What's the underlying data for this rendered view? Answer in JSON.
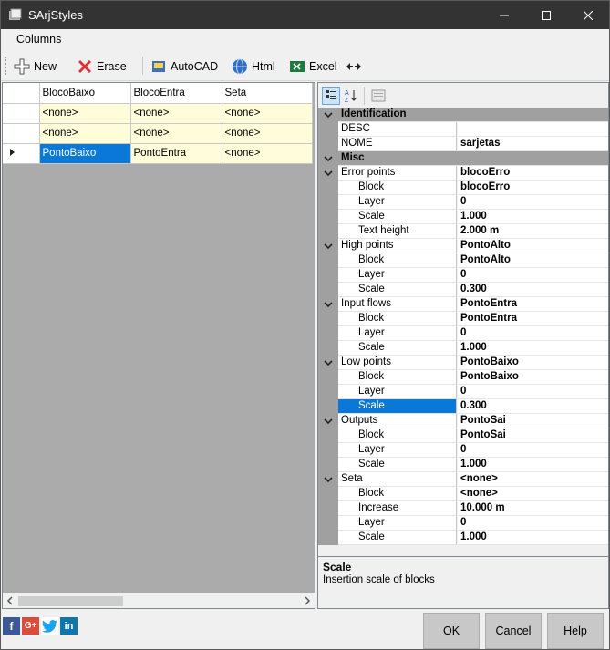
{
  "window": {
    "title": "SArjStyles"
  },
  "menu": {
    "columns": "Columns"
  },
  "toolbar": {
    "new": "New",
    "erase": "Erase",
    "autocad": "AutoCAD",
    "html": "Html",
    "excel": "Excel"
  },
  "grid": {
    "columns": [
      "BlocoBaixo",
      "BlocoEntra",
      "Seta"
    ],
    "rows": [
      [
        "<none>",
        "<none>",
        "<none>"
      ],
      [
        "<none>",
        "<none>",
        "<none>"
      ],
      [
        "PontoBaixo",
        "PontoEntra",
        "<none>"
      ]
    ]
  },
  "props": {
    "identification": {
      "label": "Identification",
      "desc": "DESC",
      "desc_value": "",
      "nome": "NOME",
      "nome_value": "sarjetas"
    },
    "misc": {
      "label": "Misc"
    },
    "error": {
      "label": "Error points",
      "value": "blocoErro",
      "block": "Block",
      "block_value": "blocoErro",
      "layer": "Layer",
      "layer_value": "0",
      "scale": "Scale",
      "scale_value": "1.000",
      "text_height": "Text height",
      "text_height_value": "2.000 m"
    },
    "high": {
      "label": "High points",
      "value": "PontoAlto",
      "block": "Block",
      "block_value": "PontoAlto",
      "layer": "Layer",
      "layer_value": "0",
      "scale": "Scale",
      "scale_value": "0.300"
    },
    "input": {
      "label": "Input flows",
      "value": "PontoEntra",
      "block": "Block",
      "block_value": "PontoEntra",
      "layer": "Layer",
      "layer_value": "0",
      "scale": "Scale",
      "scale_value": "1.000"
    },
    "low": {
      "label": "Low points",
      "value": "PontoBaixo",
      "block": "Block",
      "block_value": "PontoBaixo",
      "layer": "Layer",
      "layer_value": "0",
      "scale": "Scale",
      "scale_value": "0.300"
    },
    "outputs": {
      "label": "Outputs",
      "value": "PontoSai",
      "block": "Block",
      "block_value": "PontoSai",
      "layer": "Layer",
      "layer_value": "0",
      "scale": "Scale",
      "scale_value": "1.000"
    },
    "seta": {
      "label": "Seta",
      "value": "<none>",
      "block": "Block",
      "block_value": "<none>",
      "increase": "Increase",
      "increase_value": "10.000 m",
      "layer": "Layer",
      "layer_value": "0",
      "scale": "Scale",
      "scale_value": "1.000"
    }
  },
  "description": {
    "title": "Scale",
    "text": "Insertion scale of blocks"
  },
  "buttons": {
    "ok": "OK",
    "cancel": "Cancel",
    "help": "Help"
  },
  "colors": {
    "titlebar": "#333333",
    "selection": "#0a78d7",
    "cell": "#fffcd9"
  }
}
